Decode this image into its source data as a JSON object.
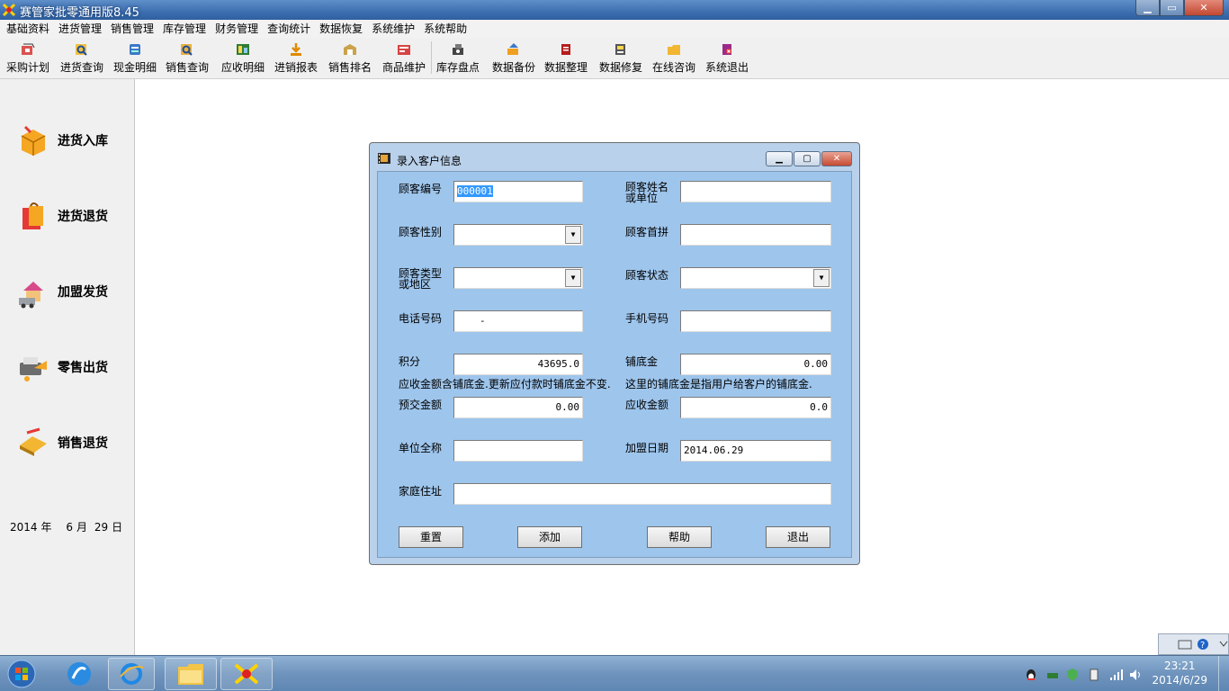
{
  "window": {
    "title": "赛管家批零通用版8.45"
  },
  "menu": [
    "基础资料",
    "进货管理",
    "销售管理",
    "库存管理",
    "财务管理",
    "查询统计",
    "数据恢复",
    "系统维护",
    "系统帮助"
  ],
  "toolbar": [
    {
      "label": "采购计划",
      "icon": "purchase-plan-icon"
    },
    {
      "label": "进货查询",
      "icon": "purchase-query-icon"
    },
    {
      "label": "现金明细",
      "icon": "cash-detail-icon"
    },
    {
      "label": "销售查询",
      "icon": "sales-query-icon"
    },
    {
      "label": "应收明细",
      "icon": "receivable-detail-icon"
    },
    {
      "label": "进销报表",
      "icon": "report-icon"
    },
    {
      "label": "销售排名",
      "icon": "sales-rank-icon"
    },
    {
      "label": "商品维护",
      "icon": "goods-maintain-icon"
    },
    {
      "label": "库存盘点",
      "icon": "inventory-icon"
    },
    {
      "label": "数据备份",
      "icon": "backup-icon"
    },
    {
      "label": "数据整理",
      "icon": "data-organize-icon"
    },
    {
      "label": "数据修复",
      "icon": "data-repair-icon"
    },
    {
      "label": "在线咨询",
      "icon": "online-consult-icon"
    },
    {
      "label": "系统退出",
      "icon": "exit-icon"
    }
  ],
  "sidebar": {
    "items": [
      {
        "label": "进货入库",
        "icon": "purchase-in-icon"
      },
      {
        "label": "进货退货",
        "icon": "purchase-return-icon"
      },
      {
        "label": "加盟发货",
        "icon": "franchise-ship-icon"
      },
      {
        "label": "零售出货",
        "icon": "retail-out-icon"
      },
      {
        "label": "销售退货",
        "icon": "sales-return-icon"
      }
    ],
    "date": {
      "year": "2014",
      "year_unit": "年",
      "month": "6",
      "month_unit": "月",
      "day": "29",
      "day_unit": "日"
    }
  },
  "dialog": {
    "title": "录入客户信息",
    "labels": {
      "customer_id": "顾客编号",
      "customer_name_1": "顾客姓名",
      "customer_name_2": "或单位",
      "gender": "顾客性别",
      "initials": "顾客首拼",
      "type_1": "顾客类型",
      "type_2": "或地区",
      "status": "顾客状态",
      "phone": "电话号码",
      "mobile": "手机号码",
      "points": "积分",
      "deposit": "铺底金",
      "prepaid": "预交金额",
      "receivable": "应收金额",
      "company": "单位全称",
      "join_date": "加盟日期",
      "address": "家庭住址"
    },
    "values": {
      "customer_id": "000001",
      "phone": "-",
      "points": "43695.0",
      "deposit": "0.00",
      "prepaid": "0.00",
      "receivable": "0.0",
      "join_date": "2014.06.29"
    },
    "notes": {
      "left": "应收金额含铺底金.更新应付款时铺底金不变.",
      "right": "这里的铺底金是指用户给客户的铺底金."
    },
    "buttons": {
      "reset": "重置",
      "add": "添加",
      "help": "帮助",
      "exit": "退出"
    }
  },
  "taskbar": {
    "time": "23:21",
    "date": "2014/6/29"
  }
}
